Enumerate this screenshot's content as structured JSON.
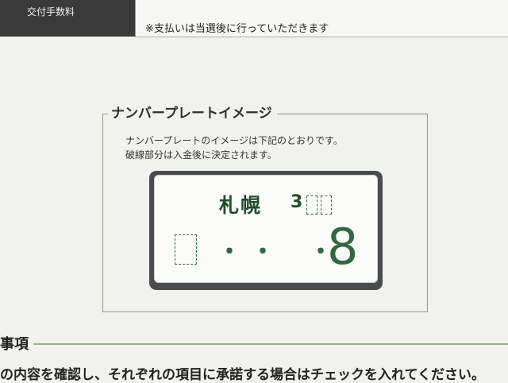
{
  "fee_row": {
    "label": "交付手数料",
    "note": "※支払いは当選後に行っていただきます"
  },
  "image_section": {
    "title": "ナンバープレートイメージ",
    "description_line1": "ナンバープレートのイメージは下記のとおりです。",
    "description_line2": "破線部分は入金後に決定されます。"
  },
  "plate": {
    "region": "札幌",
    "class_prefix": "3",
    "dot": "・",
    "last_digit": "8"
  },
  "notes_section": {
    "title": "事項",
    "instruction": "の内容を確認し、それぞれの項目に承諾する場合はチェックを入れてください。"
  },
  "colors": {
    "plate_text": "#2f6a3e",
    "section_rule": "#9bb472",
    "header_cell": "#3a3a3a"
  }
}
